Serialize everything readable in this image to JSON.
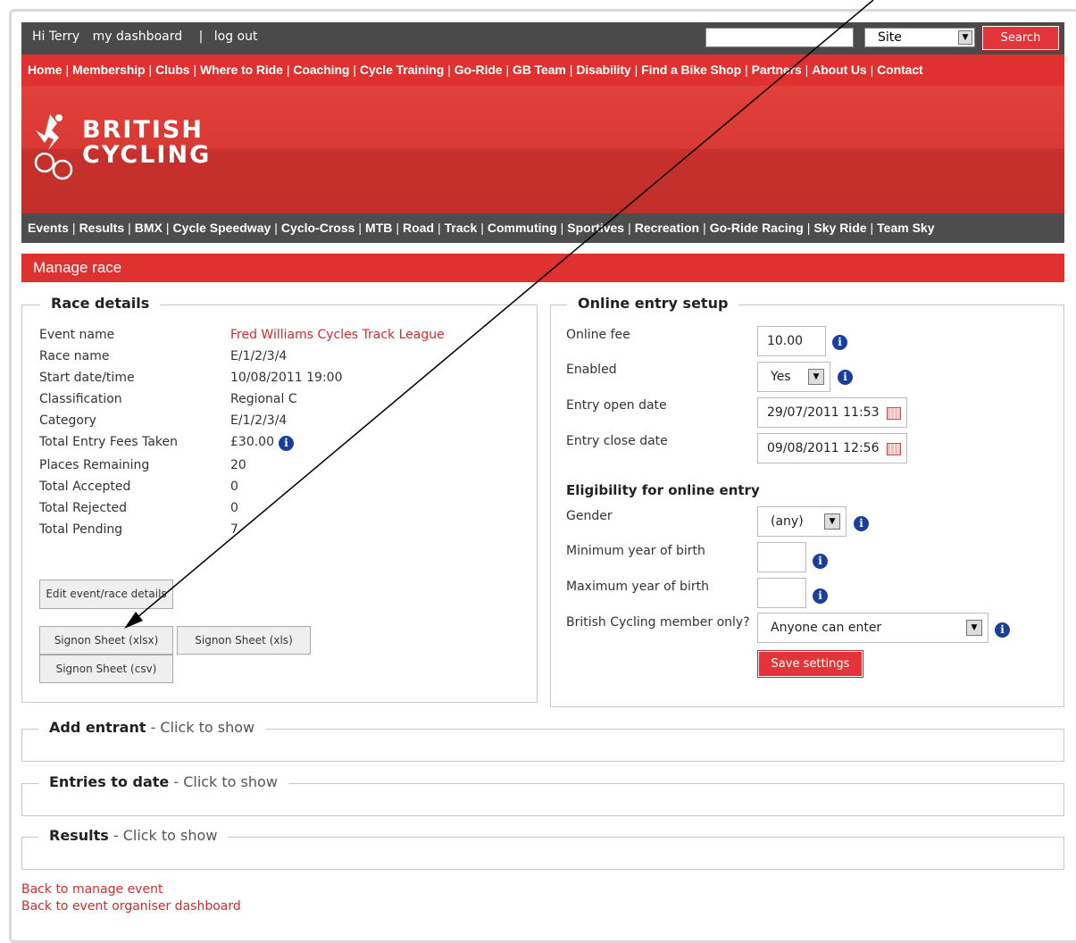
{
  "user": {
    "greeting": "Hi Terry",
    "dashboard": "my dashboard",
    "divider": "|",
    "logout": "log out"
  },
  "search": {
    "scope": "Site",
    "button": "Search"
  },
  "main_nav": [
    "Home",
    "Membership",
    "Clubs",
    "Where to Ride",
    "Coaching",
    "Cycle Training",
    "Go-Ride",
    "GB Team",
    "Disability",
    "Find a Bike Shop",
    "Partners",
    "About Us",
    "Contact"
  ],
  "logo": {
    "line1": "BRITISH",
    "line2": "CYCLING"
  },
  "sub_nav": [
    "Events",
    "Results",
    "BMX",
    "Cycle Speedway",
    "Cyclo-Cross",
    "MTB",
    "Road",
    "Track",
    "Commuting",
    "Sportives",
    "Recreation",
    "Go-Ride Racing",
    "Sky Ride",
    "Team Sky"
  ],
  "page_title": "Manage race",
  "race_details": {
    "legend": "Race details",
    "rows": [
      {
        "label": "Event name",
        "value": "Fred Williams Cycles Track League"
      },
      {
        "label": "Race name",
        "value": "E/1/2/3/4"
      },
      {
        "label": "Start date/time",
        "value": "10/08/2011 19:00"
      },
      {
        "label": "Classification",
        "value": "Regional C"
      },
      {
        "label": "Category",
        "value": "E/1/2/3/4"
      },
      {
        "label": "Total Entry Fees Taken",
        "value": "£30.00"
      },
      {
        "label": "Places Remaining",
        "value": "20"
      },
      {
        "label": "Total Accepted",
        "value": "0"
      },
      {
        "label": "Total Rejected",
        "value": "0"
      },
      {
        "label": "Total Pending",
        "value": "7"
      }
    ],
    "edit_button": "Edit event/race details",
    "signon_xlsx": "Signon Sheet (xlsx)",
    "signon_xls": "Signon Sheet (xls)",
    "signon_csv": "Signon Sheet (csv)"
  },
  "online_entry": {
    "legend": "Online entry setup",
    "fee_label": "Online fee",
    "fee_value": "10.00",
    "enabled_label": "Enabled",
    "enabled_value": "Yes",
    "open_label": "Entry open date",
    "open_value": "29/07/2011 11:53",
    "close_label": "Entry close date",
    "close_value": "09/08/2011 12:56",
    "eligibility_heading": "Eligibility for online entry",
    "gender_label": "Gender",
    "gender_value": "(any)",
    "min_yob_label": "Minimum year of birth",
    "min_yob_value": "",
    "max_yob_label": "Maximum year of birth",
    "max_yob_value": "",
    "member_label": "British Cycling member only?",
    "member_value": "Anyone can enter",
    "save_button": "Save settings"
  },
  "sections": [
    {
      "title": "Add entrant",
      "hint": " - Click to show"
    },
    {
      "title": "Entries to date",
      "hint": " - Click to show"
    },
    {
      "title": "Results",
      "hint": " - Click to show"
    }
  ],
  "footer_links": [
    "Back to manage event",
    "Back to event organiser dashboard"
  ],
  "colors": {
    "brand_red": "#e03131",
    "dark_bar": "#4a4a4a",
    "info_blue": "#1a3e9c",
    "link_red": "#d42a2a"
  },
  "icons": [
    "info-icon",
    "calendar-icon",
    "dropdown-arrow-icon",
    "cyclist-logo-icon"
  ]
}
